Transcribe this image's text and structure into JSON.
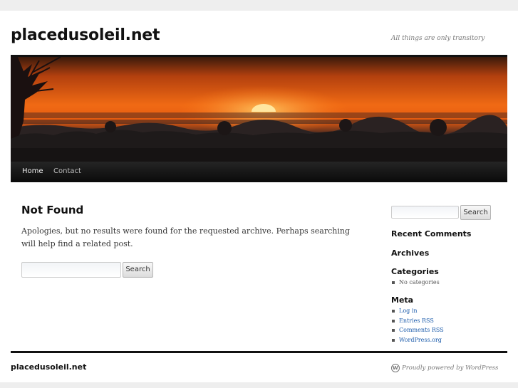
{
  "header": {
    "site_title": "placedusoleil.net",
    "tagline": "All things are only transitory"
  },
  "nav": {
    "items": [
      {
        "label": "Home"
      },
      {
        "label": "Contact"
      }
    ]
  },
  "main": {
    "title": "Not Found",
    "message": "Apologies, but no results were found for the requested archive. Perhaps searching will help find a related post.",
    "search": {
      "value": "",
      "placeholder": "",
      "button_label": "Search"
    }
  },
  "sidebar": {
    "search": {
      "value": "",
      "placeholder": "",
      "button_label": "Search"
    },
    "recent_comments_title": "Recent Comments",
    "archives_title": "Archives",
    "categories_title": "Categories",
    "categories_items": [
      "No categories"
    ],
    "meta_title": "Meta",
    "meta_items": [
      "Log in",
      "Entries RSS",
      "Comments RSS",
      "WordPress.org"
    ]
  },
  "footer": {
    "site_name": "placedusoleil.net",
    "powered": "Proudly powered by WordPress",
    "icon": "wordpress-icon"
  },
  "colors": {
    "link": "#1b5bab",
    "nav_bg": "#111111",
    "sun": "#ffe7a0"
  }
}
